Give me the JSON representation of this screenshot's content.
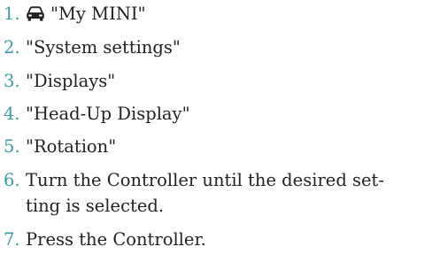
{
  "steps": [
    {
      "number": "1.",
      "text": "\"My MINI\"",
      "icon": "car-icon"
    },
    {
      "number": "2.",
      "text": "\"System settings\""
    },
    {
      "number": "3.",
      "text": "\"Displays\""
    },
    {
      "number": "4.",
      "text": "\"Head-Up Display\""
    },
    {
      "number": "5.",
      "text": "\"Rotation\""
    },
    {
      "number": "6.",
      "text_line1": "Turn the Controller until the desired set-",
      "text_line2": "ting is selected."
    },
    {
      "number": "7.",
      "text": "Press the Controller."
    }
  ],
  "colors": {
    "number": "#3a9aa6",
    "text": "#222222",
    "background": "#ffffff"
  }
}
